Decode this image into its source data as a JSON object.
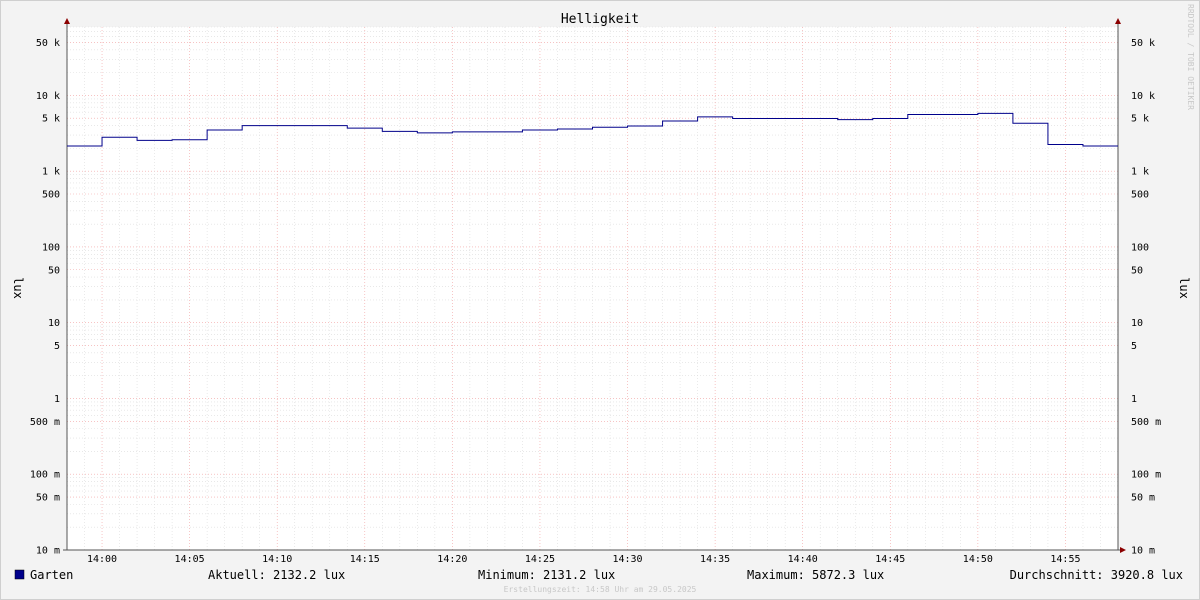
{
  "chart_data": {
    "type": "line",
    "title": "Helligkeit",
    "ylabel": "lux",
    "yscale": "log",
    "ylim": [
      0.01,
      80000
    ],
    "y_tick_labels": [
      "50 k",
      "10 k",
      "5 k",
      "1 k",
      "500",
      "100",
      "50",
      "10",
      "5",
      "1",
      "500 m",
      "100 m",
      "50 m",
      "10 m"
    ],
    "y_tick_values": [
      50000,
      10000,
      5000,
      1000,
      500,
      100,
      50,
      10,
      5,
      1,
      0.5,
      0.1,
      0.05,
      0.01
    ],
    "x_tick_labels": [
      "14:00",
      "14:05",
      "14:10",
      "14:15",
      "14:20",
      "14:25",
      "14:30",
      "14:35",
      "14:40",
      "14:45",
      "14:50",
      "14:55"
    ],
    "x_tick_minutes": [
      0,
      5,
      10,
      15,
      20,
      25,
      30,
      35,
      40,
      45,
      50,
      55
    ],
    "xlim_minutes": [
      -2.0,
      58.0
    ],
    "grid": true,
    "series": [
      {
        "name": "Garten",
        "color": "#00008b",
        "step_starts_minutes": [
          -2.0,
          0.0,
          2.0,
          4.0,
          6.0,
          8.0,
          10.0,
          12.0,
          14.0,
          16.0,
          18.0,
          20.0,
          22.0,
          24.0,
          26.0,
          28.0,
          30.0,
          32.0,
          34.0,
          36.0,
          38.0,
          40.0,
          42.0,
          44.0,
          46.0,
          48.0,
          50.0,
          52.0,
          54.0,
          56.0,
          58.0
        ],
        "values": [
          2150,
          2800,
          2550,
          2600,
          3500,
          4000,
          4000,
          4000,
          3700,
          3350,
          3200,
          3300,
          3300,
          3500,
          3600,
          3800,
          3950,
          4600,
          5200,
          4950,
          4950,
          4950,
          4800,
          4950,
          5600,
          5600,
          5800,
          4300,
          2250,
          2150
        ]
      }
    ]
  },
  "legend": {
    "series_name": "Garten",
    "swatch_color": "#00008b",
    "current": "Aktuell: 2132.2 lux",
    "minimum": "Minimum: 2131.2 lux",
    "maximum": "Maximum: 5872.3 lux",
    "average": "Durchschnitt: 3920.8 lux"
  },
  "footer": "Erstellungszeit: 14:58 Uhr am 29.05.2025",
  "side_label": "RRDTOOL / TOBI OETIKER",
  "colors": {
    "grid_minor": "#dcdcdc",
    "grid_major": "#f2a0a0",
    "axis": "#555555",
    "arrow": "#8b0000"
  }
}
